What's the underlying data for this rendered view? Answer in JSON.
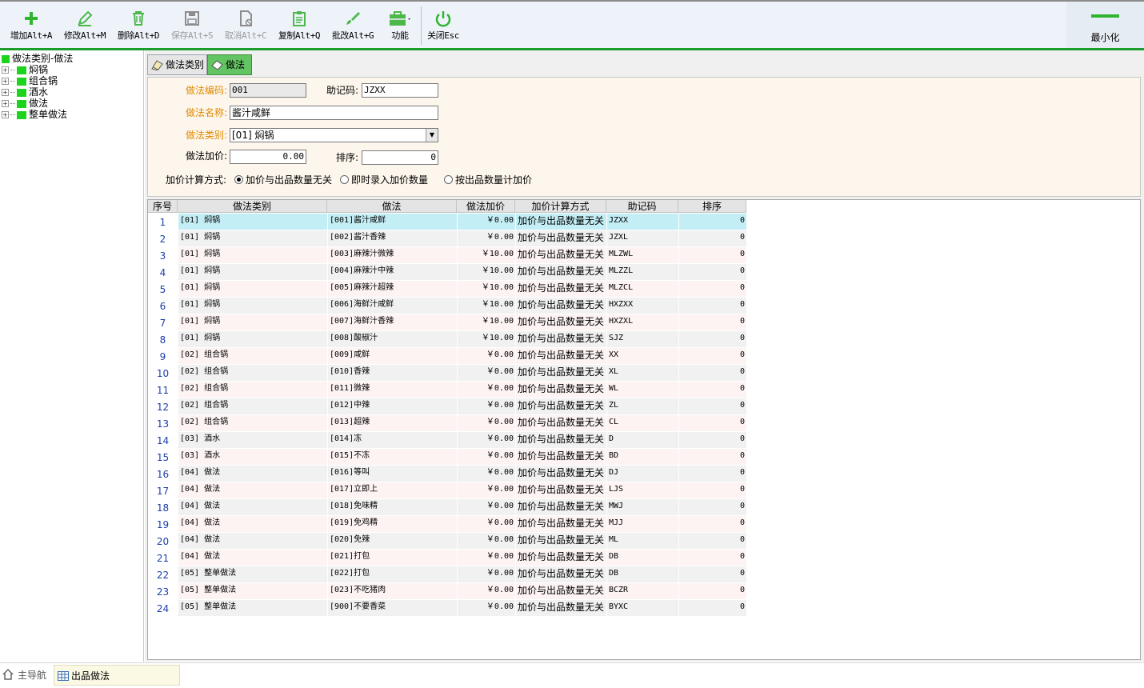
{
  "toolbar": {
    "buttons": [
      {
        "label": "增加Alt+A",
        "icon": "plus-icon",
        "enabled": true
      },
      {
        "label": "修改Alt+M",
        "icon": "pencil-icon",
        "enabled": true
      },
      {
        "label": "删除Alt+D",
        "icon": "trash-icon",
        "enabled": true
      },
      {
        "label": "保存Alt+S",
        "icon": "save-icon",
        "enabled": false
      },
      {
        "label": "取消Alt+C",
        "icon": "cancel-doc-icon",
        "enabled": false
      },
      {
        "label": "复制Alt+Q",
        "icon": "copy-icon",
        "enabled": true
      },
      {
        "label": "批改Alt+G",
        "icon": "brush-icon",
        "enabled": true
      },
      {
        "label": "功能",
        "icon": "briefcase-icon",
        "enabled": true
      },
      {
        "label": "关闭Esc",
        "icon": "power-icon",
        "enabled": true
      }
    ],
    "minimize_label": "最小化",
    "accent": "#1c9c2c"
  },
  "tree": {
    "root": "做法类别-做法",
    "items": [
      "焖锅",
      "组合锅",
      "酒水",
      "做法",
      "整单做法"
    ]
  },
  "tabs": [
    {
      "label": "做法类别",
      "active": false
    },
    {
      "label": "做法",
      "active": true
    }
  ],
  "form": {
    "code_label": "做法编码:",
    "code_value": "001",
    "mnemonic_label": "助记码:",
    "mnemonic_value": "JZXX",
    "name_label": "做法名称:",
    "name_value": "酱汁咸鲜",
    "category_label": "做法类别:",
    "category_value": "[01] 焖锅",
    "price_label": "做法加价:",
    "price_value": "0.00",
    "sort_label": "排序:",
    "sort_value": "0",
    "calc_label": "加价计算方式:",
    "calc_options": [
      "加价与出品数量无关",
      "即时录入加价数量",
      "按出品数量计加价"
    ],
    "calc_selected": 0
  },
  "grid": {
    "headers": [
      "序号",
      "做法类别",
      "做法",
      "做法加价",
      "加价计算方式",
      "助记码",
      "排序"
    ],
    "rows": [
      {
        "no": "1",
        "category": "[01] 焖锅",
        "name": "[001]酱汁咸鲜",
        "price": "￥0.00",
        "calc": "加价与出品数量无关",
        "code": "JZXX",
        "sort": "0"
      },
      {
        "no": "2",
        "category": "[01] 焖锅",
        "name": "[002]酱汁香辣",
        "price": "￥0.00",
        "calc": "加价与出品数量无关",
        "code": "JZXL",
        "sort": "0"
      },
      {
        "no": "3",
        "category": "[01] 焖锅",
        "name": "[003]麻辣汁微辣",
        "price": "￥10.00",
        "calc": "加价与出品数量无关",
        "code": "MLZWL",
        "sort": "0"
      },
      {
        "no": "4",
        "category": "[01] 焖锅",
        "name": "[004]麻辣汁中辣",
        "price": "￥10.00",
        "calc": "加价与出品数量无关",
        "code": "MLZZL",
        "sort": "0"
      },
      {
        "no": "5",
        "category": "[01] 焖锅",
        "name": "[005]麻辣汁超辣",
        "price": "￥10.00",
        "calc": "加价与出品数量无关",
        "code": "MLZCL",
        "sort": "0"
      },
      {
        "no": "6",
        "category": "[01] 焖锅",
        "name": "[006]海鲜汁咸鲜",
        "price": "￥10.00",
        "calc": "加价与出品数量无关",
        "code": "HXZXX",
        "sort": "0"
      },
      {
        "no": "7",
        "category": "[01] 焖锅",
        "name": "[007]海鲜汁香辣",
        "price": "￥10.00",
        "calc": "加价与出品数量无关",
        "code": "HXZXL",
        "sort": "0"
      },
      {
        "no": "8",
        "category": "[01] 焖锅",
        "name": "[008]酸椒汁",
        "price": "￥10.00",
        "calc": "加价与出品数量无关",
        "code": "SJZ",
        "sort": "0"
      },
      {
        "no": "9",
        "category": "[02] 组合锅",
        "name": "[009]咸鲜",
        "price": "￥0.00",
        "calc": "加价与出品数量无关",
        "code": "XX",
        "sort": "0"
      },
      {
        "no": "10",
        "category": "[02] 组合锅",
        "name": "[010]香辣",
        "price": "￥0.00",
        "calc": "加价与出品数量无关",
        "code": "XL",
        "sort": "0"
      },
      {
        "no": "11",
        "category": "[02] 组合锅",
        "name": "[011]微辣",
        "price": "￥0.00",
        "calc": "加价与出品数量无关",
        "code": "WL",
        "sort": "0"
      },
      {
        "no": "12",
        "category": "[02] 组合锅",
        "name": "[012]中辣",
        "price": "￥0.00",
        "calc": "加价与出品数量无关",
        "code": "ZL",
        "sort": "0"
      },
      {
        "no": "13",
        "category": "[02] 组合锅",
        "name": "[013]超辣",
        "price": "￥0.00",
        "calc": "加价与出品数量无关",
        "code": "CL",
        "sort": "0"
      },
      {
        "no": "14",
        "category": "[03] 酒水",
        "name": "[014]冻",
        "price": "￥0.00",
        "calc": "加价与出品数量无关",
        "code": "D",
        "sort": "0"
      },
      {
        "no": "15",
        "category": "[03] 酒水",
        "name": "[015]不冻",
        "price": "￥0.00",
        "calc": "加价与出品数量无关",
        "code": "BD",
        "sort": "0"
      },
      {
        "no": "16",
        "category": "[04] 做法",
        "name": "[016]等叫",
        "price": "￥0.00",
        "calc": "加价与出品数量无关",
        "code": "DJ",
        "sort": "0"
      },
      {
        "no": "17",
        "category": "[04] 做法",
        "name": "[017]立即上",
        "price": "￥0.00",
        "calc": "加价与出品数量无关",
        "code": "LJS",
        "sort": "0"
      },
      {
        "no": "18",
        "category": "[04] 做法",
        "name": "[018]免味精",
        "price": "￥0.00",
        "calc": "加价与出品数量无关",
        "code": "MWJ",
        "sort": "0"
      },
      {
        "no": "19",
        "category": "[04] 做法",
        "name": "[019]免鸡精",
        "price": "￥0.00",
        "calc": "加价与出品数量无关",
        "code": "MJJ",
        "sort": "0"
      },
      {
        "no": "20",
        "category": "[04] 做法",
        "name": "[020]免辣",
        "price": "￥0.00",
        "calc": "加价与出品数量无关",
        "code": "ML",
        "sort": "0"
      },
      {
        "no": "21",
        "category": "[04] 做法",
        "name": "[021]打包",
        "price": "￥0.00",
        "calc": "加价与出品数量无关",
        "code": "DB",
        "sort": "0"
      },
      {
        "no": "22",
        "category": "[05] 整单做法",
        "name": "[022]打包",
        "price": "￥0.00",
        "calc": "加价与出品数量无关",
        "code": "DB",
        "sort": "0"
      },
      {
        "no": "23",
        "category": "[05] 整单做法",
        "name": "[023]不吃猪肉",
        "price": "￥0.00",
        "calc": "加价与出品数量无关",
        "code": "BCZR",
        "sort": "0"
      },
      {
        "no": "24",
        "category": "[05] 整单做法",
        "name": "[900]不要香菜",
        "price": "￥0.00",
        "calc": "加价与出品数量无关",
        "code": "BYXC",
        "sort": "0"
      }
    ],
    "selected_row": 0
  },
  "status": {
    "home_label": "主导航",
    "window_label": "出品做法"
  }
}
